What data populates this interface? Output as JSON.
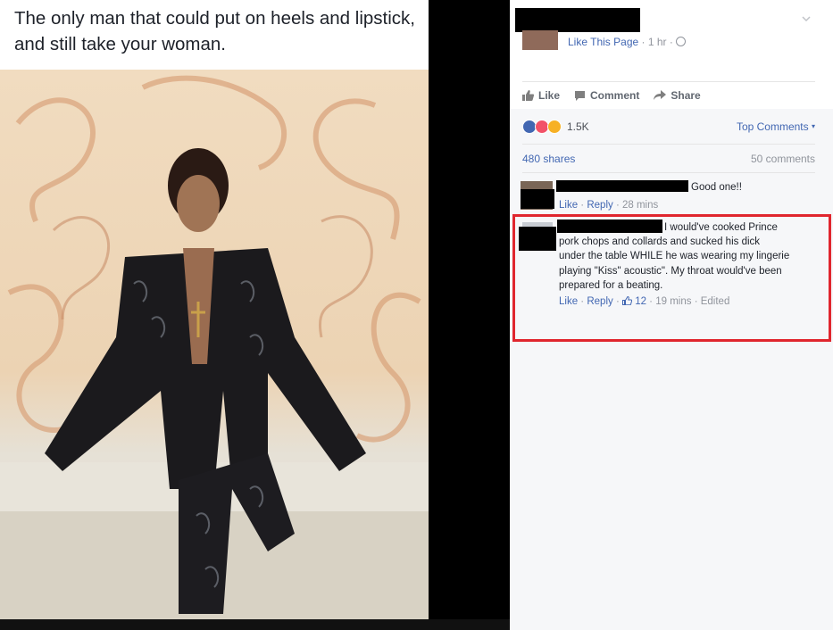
{
  "post": {
    "caption": "The only man that could put on heels and lipstick, and still take your woman."
  },
  "header": {
    "like_page_label": "Like This Page",
    "separator": "·",
    "time": "1 hr"
  },
  "actions": [
    {
      "label": "Like",
      "icon": "thumbs-up-icon"
    },
    {
      "label": "Comment",
      "icon": "comment-icon"
    },
    {
      "label": "Share",
      "icon": "share-arrow-icon"
    }
  ],
  "stats": {
    "reaction_count": "1.5K",
    "reaction_icons": [
      "like-reaction-icon",
      "love-reaction-icon",
      "haha-reaction-icon"
    ],
    "top_comments_label": "Top Comments",
    "shares": "480 shares",
    "comments": "50 comments"
  },
  "comments": [
    {
      "text": "Good one!!",
      "like": "Like",
      "reply": "Reply",
      "time": "28 mins"
    },
    {
      "text": "I would've cooked Prince pork chops and collards and sucked his dick under the table WHILE he was wearing my lingerie playing \"Kiss\" acoustic\". My throat would've been prepared for a beating.",
      "lines": [
        "I would've cooked Prince",
        "pork chops and collards and sucked his dick",
        "under the table WHILE he was wearing my lingerie",
        "playing \"Kiss\" acoustic\". My throat would've been",
        "prepared for a beating."
      ],
      "like": "Like",
      "reply": "Reply",
      "like_count": "12",
      "time": "19 mins",
      "edited": "Edited"
    }
  ],
  "colors": {
    "link_blue": "#4267b2",
    "meta_gray": "#90949c",
    "highlight_red": "#e0262e",
    "love_red": "#f25268",
    "haha_yellow": "#f7b125"
  }
}
